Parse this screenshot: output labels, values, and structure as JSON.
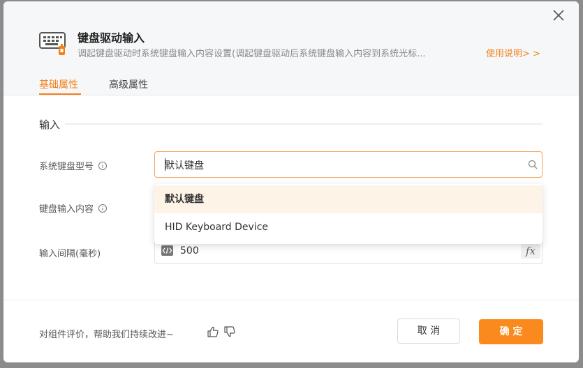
{
  "dialog": {
    "title": "键盘驱动输入",
    "description": "调起键盘驱动时系统键盘输入内容设置(调起键盘驱动后系统键盘输入内容到系统光标...",
    "help_link": "使用说明> >",
    "header_icon": "keyboard-icon"
  },
  "tabs": [
    {
      "label": "基础属性",
      "active": true
    },
    {
      "label": "高级属性",
      "active": false
    }
  ],
  "section": {
    "title": "输入"
  },
  "fields": {
    "keyboard_model": {
      "label": "系统键盘型号",
      "value": "默认键盘",
      "icon": "search-icon"
    },
    "input_content": {
      "label": "键盘输入内容"
    },
    "interval": {
      "label": "输入间隔(毫秒)",
      "value": "500",
      "fx_label": "fx",
      "icon": "code-icon"
    }
  },
  "dropdown": {
    "options": [
      "默认键盘",
      "HID Keyboard Device"
    ],
    "selected": "默认键盘"
  },
  "footer": {
    "feedback": "对组件评价，帮助我们持续改进~",
    "cancel_label": "取 消",
    "ok_label": "确 定"
  },
  "colors": {
    "accent": "#f4801a",
    "primary_button": "#fb8a1e",
    "selected_option_bg": "#fdf3e7"
  }
}
